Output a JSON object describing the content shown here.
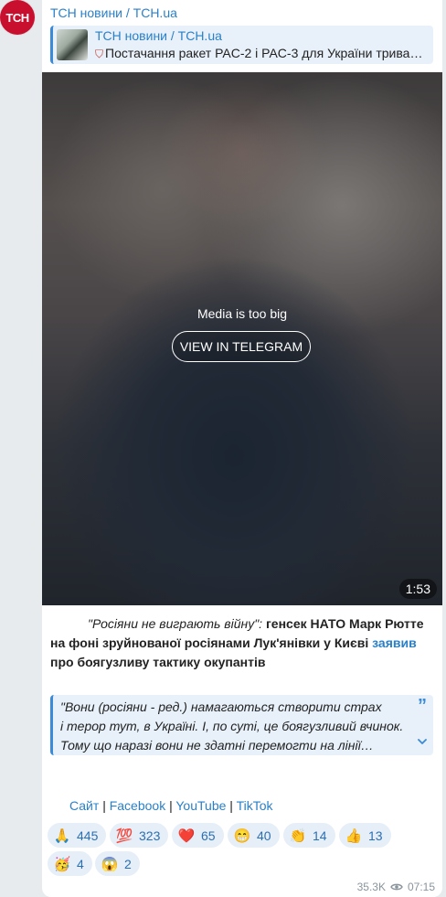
{
  "channel": {
    "avatar_text": "ТСН",
    "name": "ТСН новини / TCH.ua"
  },
  "reply": {
    "title": "ТСН новини / TCH.ua",
    "icon": "shield-icon",
    "text": "Постачання ракет PAC-2 і PAC-3 для України трива…"
  },
  "media": {
    "message": "Media is too big",
    "button": "VIEW IN TELEGRAM",
    "duration": "1:53"
  },
  "caption": {
    "quote_italic": "\"Росіяни не виграють війну\":",
    "bold_1": " генсек НАТО Марк Рютте на фоні зруйнованої росіянами Лук'янівки у Києві ",
    "link": "заявив",
    "bold_2": " про боягузливу тактику окупантів"
  },
  "blockquote": {
    "lines": [
      "\"Вони (росіяни - ред.) намагаються створити страх",
      "і терор тут, в Україні. І, по суті, це боягузливий вчинок.",
      "Тому що наразі вони не здатні перемогти на лінії…"
    ],
    "quote_icon": "”"
  },
  "links": {
    "site": "Сайт",
    "facebook": "Facebook",
    "youtube": "YouTube",
    "tiktok": "TikTok",
    "sep": "|"
  },
  "reactions": [
    {
      "emoji": "🙏",
      "count": "445"
    },
    {
      "emoji": "💯",
      "count": "323"
    },
    {
      "emoji": "❤️",
      "count": "65"
    },
    {
      "emoji": "😁",
      "count": "40"
    },
    {
      "emoji": "👏",
      "count": "14"
    },
    {
      "emoji": "👍",
      "count": "13"
    },
    {
      "emoji": "🥳",
      "count": "4"
    },
    {
      "emoji": "😱",
      "count": "2"
    }
  ],
  "footer": {
    "views": "35.3K",
    "time": "07:15"
  },
  "colors": {
    "accent": "#2a80c8",
    "brand_red": "#c8102e",
    "reaction_bg": "#e6eef7"
  }
}
